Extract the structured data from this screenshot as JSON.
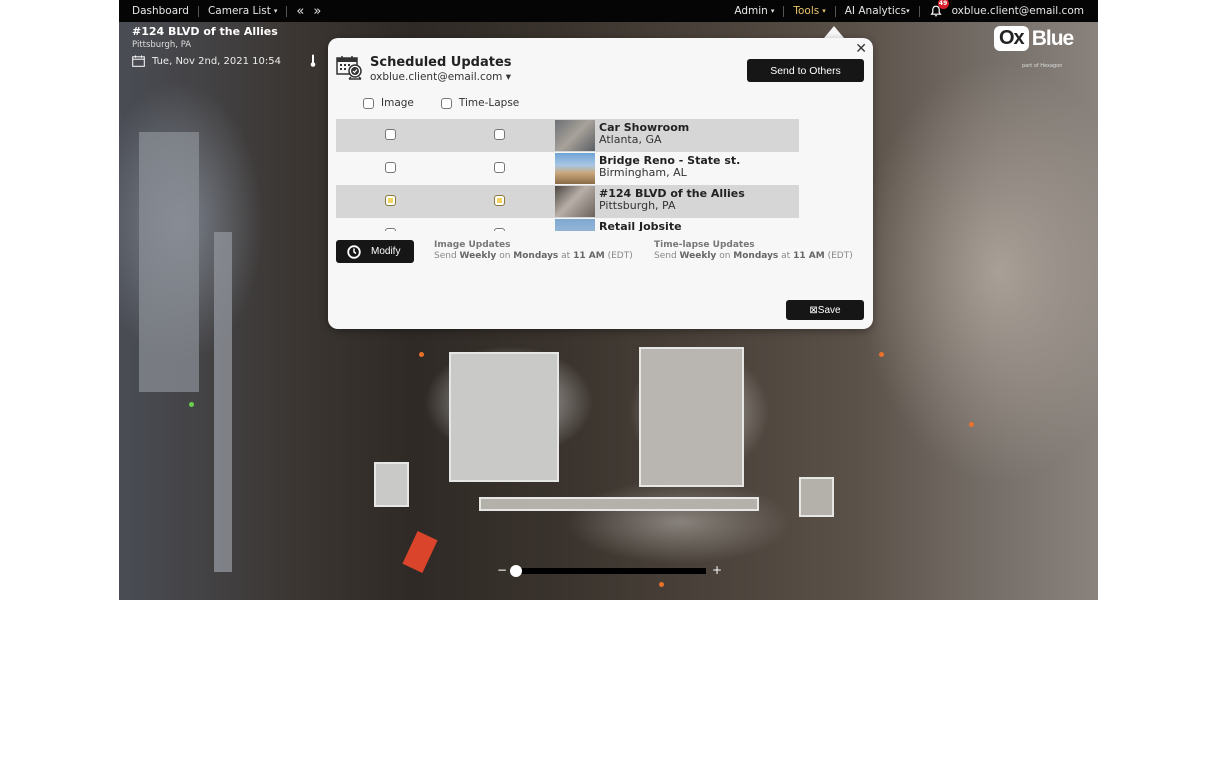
{
  "nav": {
    "dashboard": "Dashboard",
    "camera_list": "Camera List",
    "prev": "«",
    "next": "»",
    "admin": "Admin",
    "tools": "Tools",
    "ai_analytics": "AI Analytics",
    "notifications_count": "49",
    "user_email": "oxblue.client@email.com",
    "caret": "▾"
  },
  "project": {
    "title": "#124 BLVD of the Allies",
    "location": "Pittsburgh, PA",
    "datetime": "Tue, Nov 2nd, 2021 10:54"
  },
  "logo": {
    "ox": "Ox",
    "blue": "Blue",
    "sub": "part of Hexagon"
  },
  "dialog": {
    "title": "Scheduled Updates",
    "email": "oxblue.client@email.com ▾",
    "close": "✕",
    "send_to_others": "Send to Others",
    "header_image": "Image",
    "header_timelapse": "Time-Lapse",
    "sites": [
      {
        "name": "Car Showroom",
        "location": "Atlanta, GA",
        "image": false,
        "timelapse": false
      },
      {
        "name": "Bridge Reno - State st.",
        "location": "Birmingham, AL",
        "image": false,
        "timelapse": false
      },
      {
        "name": "#124 BLVD of the Allies",
        "location": "Pittsburgh, PA",
        "image": true,
        "timelapse": true
      },
      {
        "name": "Retail Jobsite",
        "location": "",
        "image": false,
        "timelapse": false
      }
    ],
    "modify": "Modify",
    "image_updates": {
      "heading": "Image Updates",
      "send": "Send",
      "frequency": "Weekly",
      "on": "on",
      "day": "Mondays",
      "at": "at",
      "time": "11 AM",
      "tz": "(EDT)"
    },
    "timelapse_updates": {
      "heading": "Time-lapse Updates",
      "send": "Send",
      "frequency": "Weekly",
      "on": "on",
      "day": "Mondays",
      "at": "at",
      "time": "11 AM",
      "tz": "(EDT)"
    },
    "save": "Save"
  },
  "timeline": {
    "minus": "−",
    "plus": "+",
    "position": 0.0
  }
}
